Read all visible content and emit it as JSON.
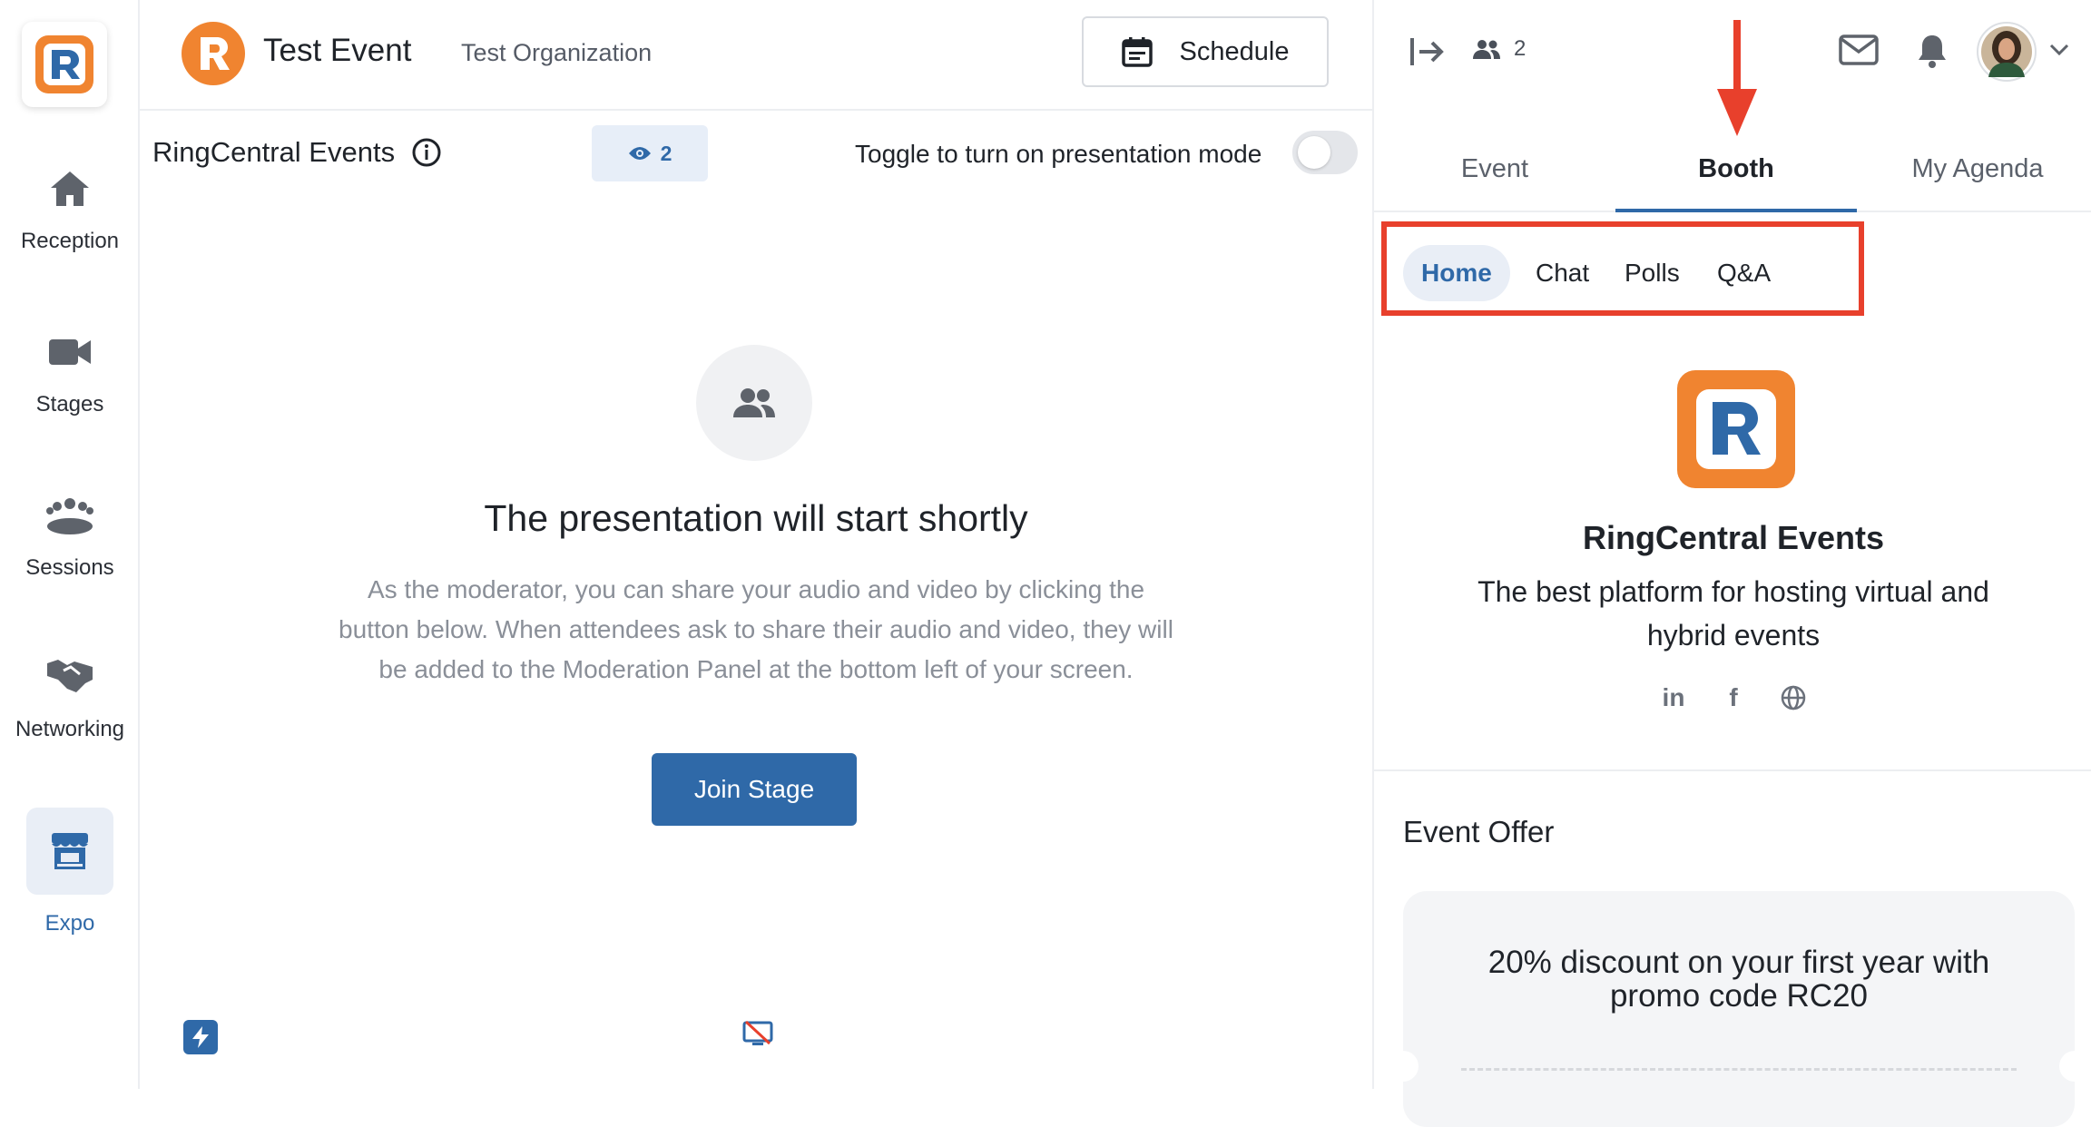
{
  "nav": {
    "items": [
      {
        "label": "Reception",
        "icon": "home-icon"
      },
      {
        "label": "Stages",
        "icon": "video-camera-icon"
      },
      {
        "label": "Sessions",
        "icon": "group-icon"
      },
      {
        "label": "Networking",
        "icon": "handshake-icon"
      },
      {
        "label": "Expo",
        "icon": "booth-icon"
      }
    ]
  },
  "header": {
    "event_title": "Test Event",
    "organization": "Test Organization",
    "schedule_label": "Schedule"
  },
  "stage": {
    "title": "RingCentral Events",
    "viewer_count": "2",
    "toggle_label": "Toggle to turn on presentation mode",
    "presentation_title": "The presentation will start shortly",
    "description": "As the moderator, you can share your audio and video by clicking the button below. When attendees ask to share their audio and video, they will be added to the Moderation Panel at the bottom left of your screen.",
    "join_label": "Join Stage"
  },
  "panel": {
    "attendee_count": "2",
    "tabs": [
      "Event",
      "Booth",
      "My Agenda"
    ],
    "active_tab": "Booth",
    "subtabs": [
      "Home",
      "Chat",
      "Polls",
      "Q&A"
    ],
    "active_subtab": "Home",
    "booth_name": "RingCentral Events",
    "booth_description": "The best platform for hosting virtual and hybrid events",
    "social_icons": [
      "linkedin-icon",
      "facebook-icon",
      "globe-icon"
    ],
    "offer_title": "Event Offer",
    "offer_text": "20% discount on your first year with promo code RC20"
  },
  "colors": {
    "accent": "#2f69a8",
    "brand_orange": "#f08430",
    "annotation_red": "#e8402c"
  }
}
